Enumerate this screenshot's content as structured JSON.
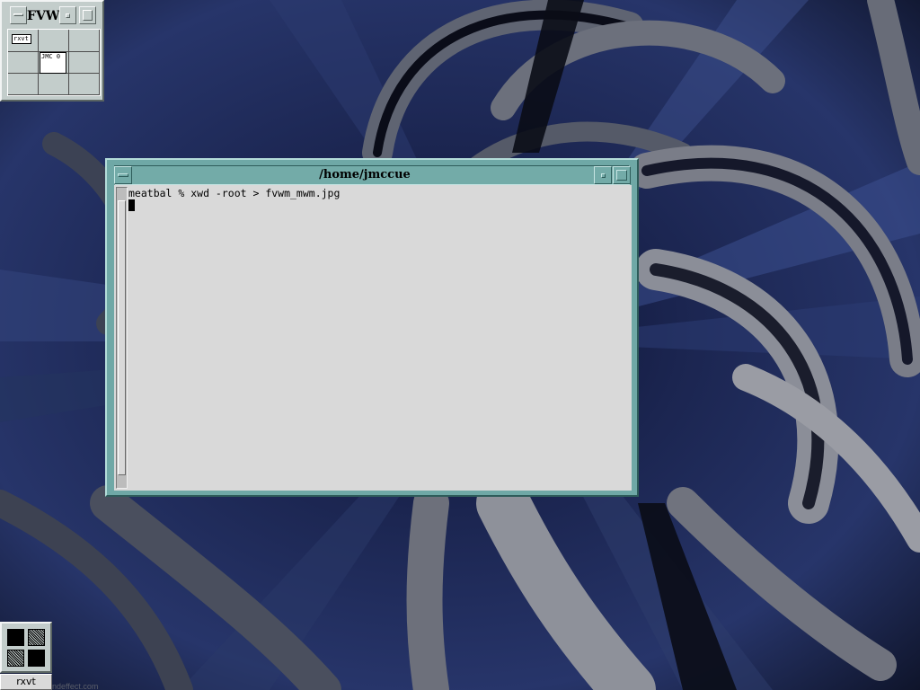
{
  "desktop": {
    "wallpaper_colors": {
      "dark": "#0b1022",
      "blue": "#2f3d73",
      "gray": "#6f7380"
    },
    "watermark": "ndeffect.com"
  },
  "pager": {
    "title": "FVW",
    "desks": [
      {
        "label": "rxvt"
      },
      {
        "label": "JMC 0"
      }
    ]
  },
  "window": {
    "title": "/home/jmccue",
    "frame_color": "#6fa8a6",
    "terminal": {
      "prompt_line": "meatbal % xwd -root > fvwm_mwm.jpg"
    }
  },
  "iconbox": {
    "label": "rxvt"
  }
}
